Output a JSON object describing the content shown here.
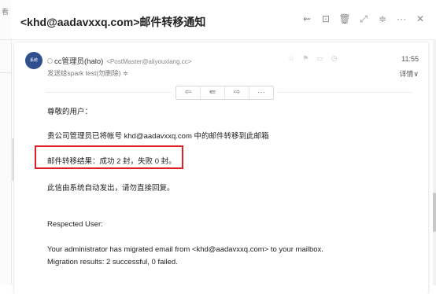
{
  "left_strip": {
    "label": "看"
  },
  "email": {
    "subject": "<khd@aadavxxq.com>邮件转移通知",
    "sender_name": "cc管理员(halo)",
    "sender_email": "<PostMaster@aliyouxiang.cc>",
    "recipient": "发送给spark test(勿删除) ≑",
    "time": "11:55",
    "details": "详情∨",
    "avatar_text": "系统"
  },
  "header_icons": [
    "reply-all-icon",
    "forward-box-icon",
    "trash-icon",
    "expand-icon",
    "move-icon",
    "more-icon",
    "close-icon"
  ],
  "header_glyphs": [
    "⇜",
    "⊡",
    "🗑",
    "⤢",
    "≑",
    "···",
    "✕"
  ],
  "meta_glyphs": [
    "☆",
    "⚑",
    "▭",
    "◷"
  ],
  "action_glyphs": [
    "⇦",
    "⇚",
    "⇨",
    "···"
  ],
  "body": {
    "greeting": "尊敬的用户：",
    "line1": "贵公司管理员已将帐号 khd@aadavxxq.com 中的邮件转移到此邮箱",
    "result": "邮件转移结果：成功 2 封，失败 0 封。",
    "auto_note": "此信由系统自动发出，请勿直接回复。",
    "en_greeting": "Respected User:",
    "en_line1": "Your administrator has migrated email from <khd@aadavxxq.com> to your mailbox.",
    "en_line2": "Migration results: 2 successful, 0 failed."
  }
}
